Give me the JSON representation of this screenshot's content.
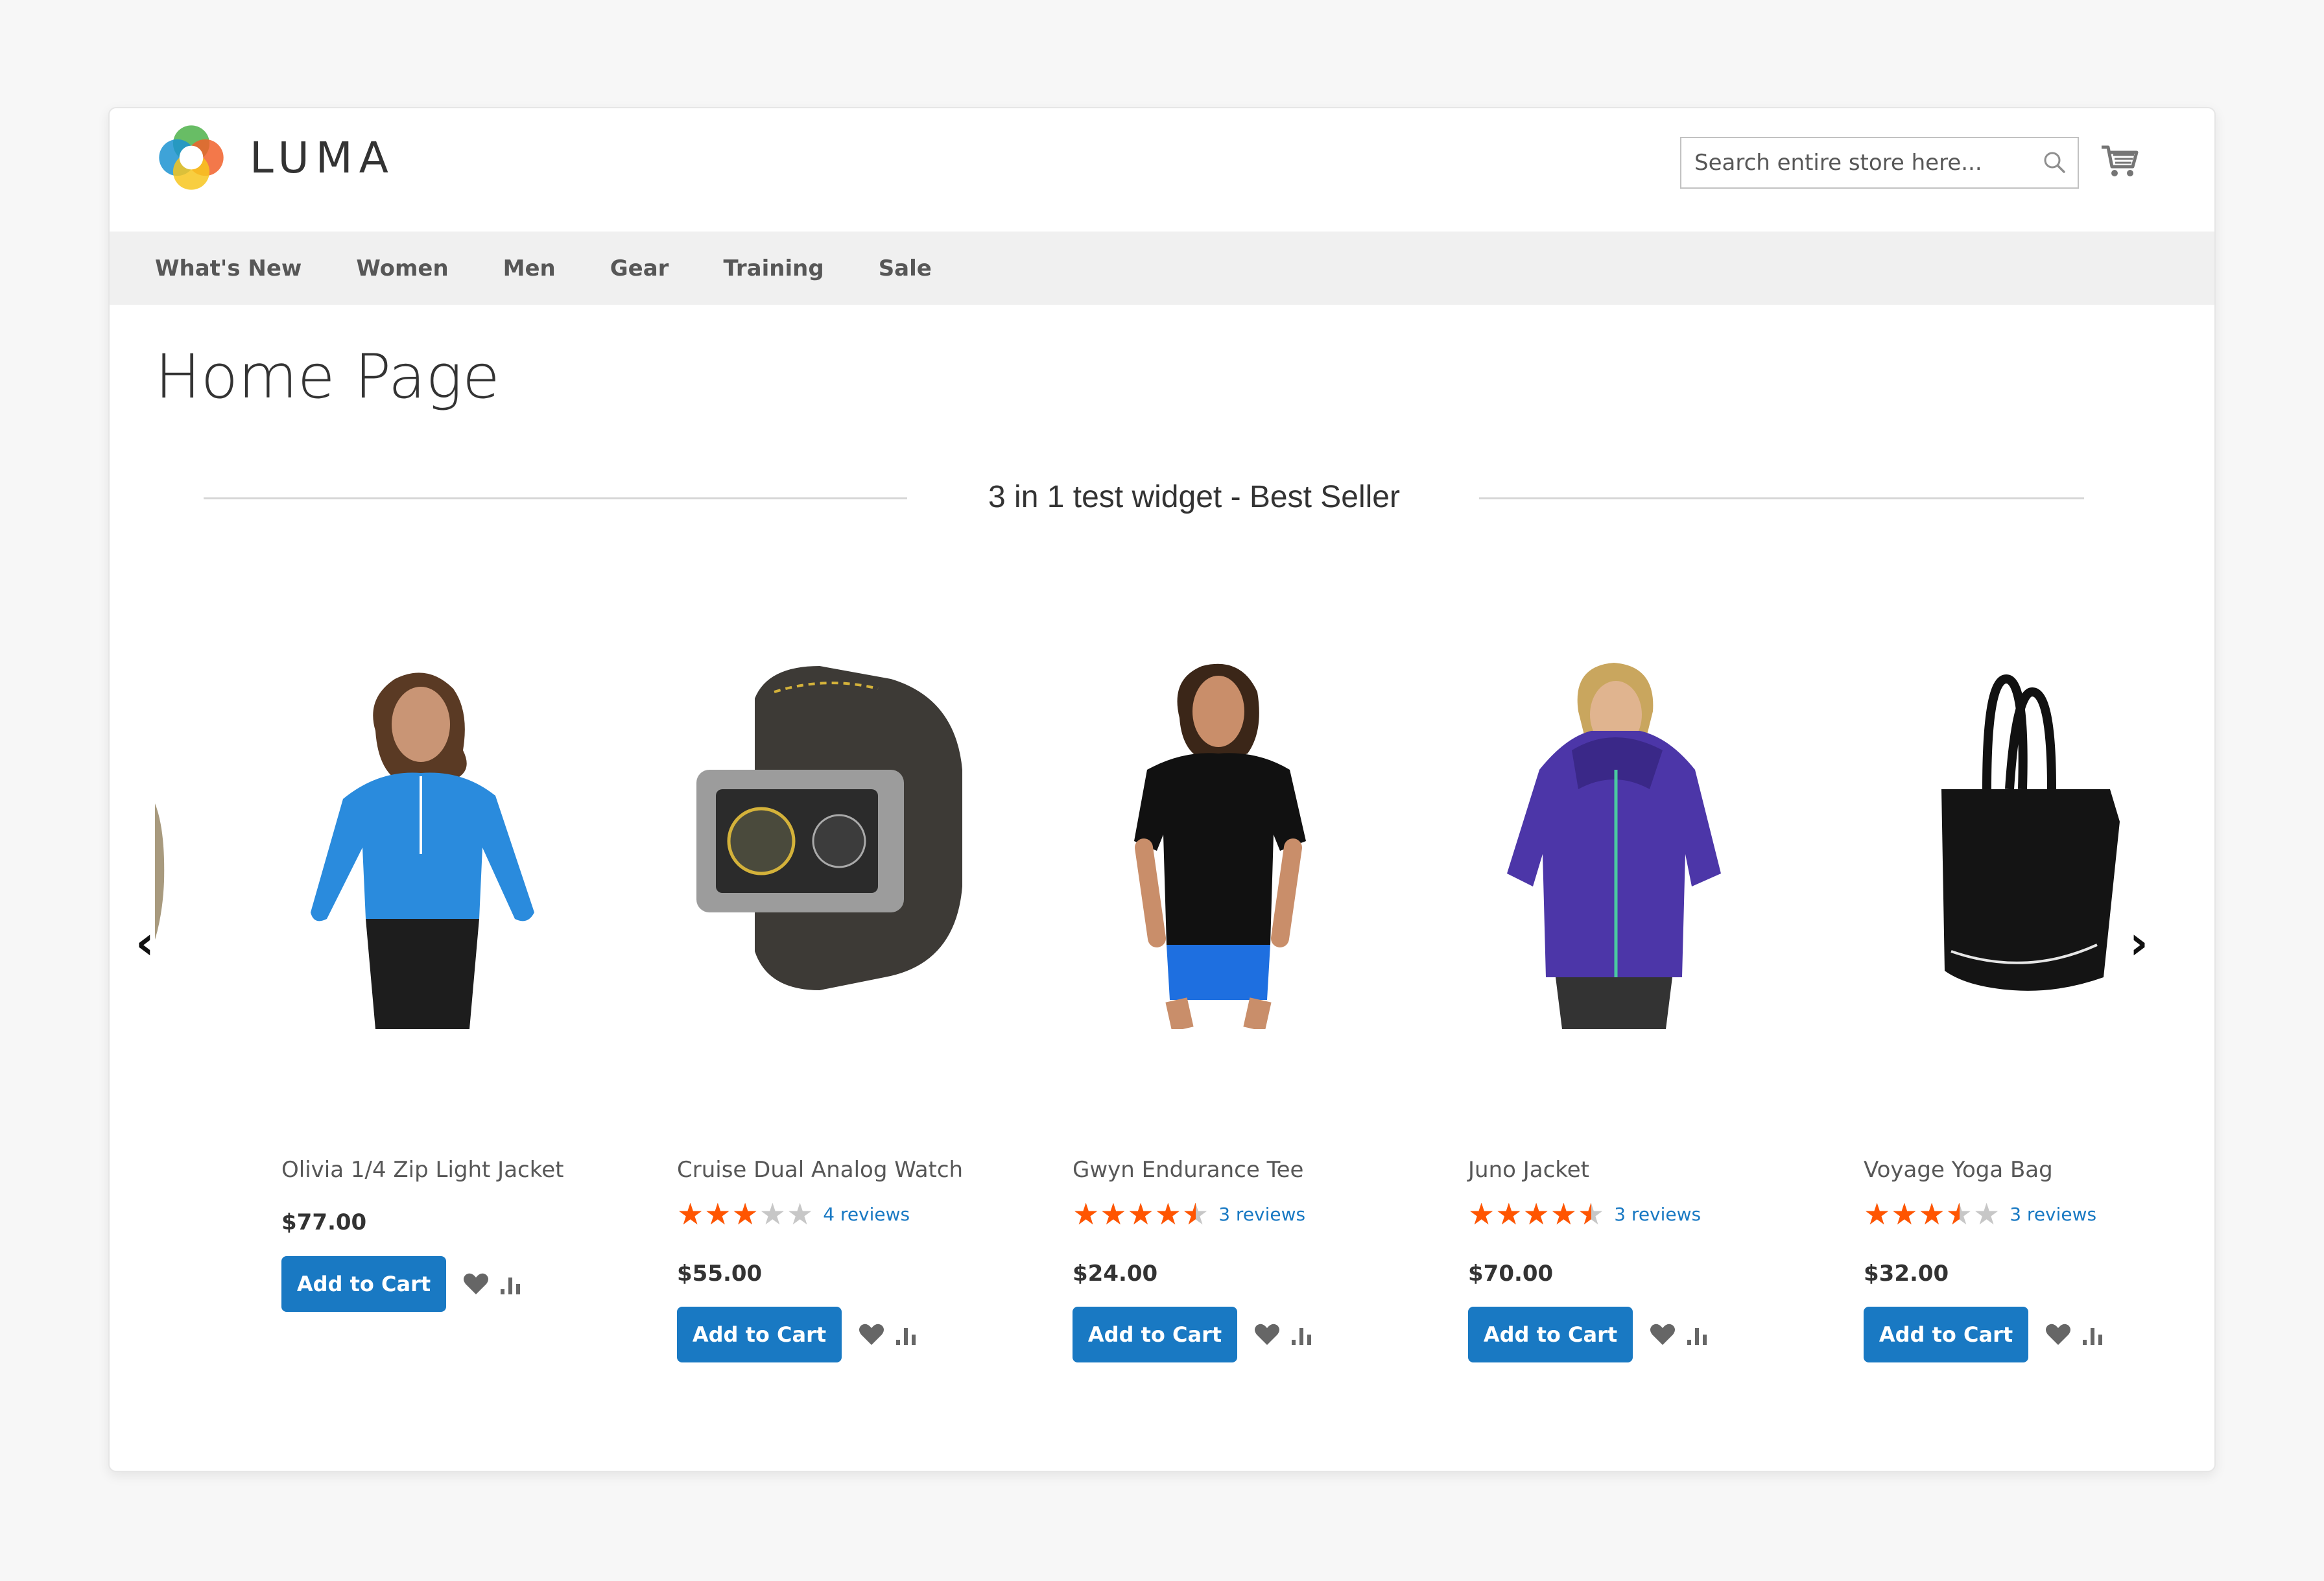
{
  "brand": {
    "name": "LUMA"
  },
  "header": {
    "search_placeholder": "Search entire store here..."
  },
  "nav": [
    "What's New",
    "Women",
    "Men",
    "Gear",
    "Training",
    "Sale"
  ],
  "page_title": "Home Page",
  "widget_title": "3 in 1 test widget - Best Seller",
  "products": [
    {
      "name": "Olivia 1/4 Zip Light Jacket",
      "price": "$77.00",
      "rating": null,
      "reviews": "",
      "add_label": "Add to Cart"
    },
    {
      "name": "Cruise Dual Analog Watch",
      "price": "$55.00",
      "rating": 3,
      "reviews": "4 reviews",
      "add_label": "Add to Cart"
    },
    {
      "name": "Gwyn Endurance Tee",
      "price": "$24.00",
      "rating": 4.5,
      "reviews": "3 reviews",
      "add_label": "Add to Cart"
    },
    {
      "name": "Juno Jacket",
      "price": "$70.00",
      "rating": 4.5,
      "reviews": "3 reviews",
      "add_label": "Add to Cart"
    },
    {
      "name": "Voyage Yoga Bag",
      "price": "$32.00",
      "rating": 3.5,
      "reviews": "3 reviews",
      "add_label": "Add to Cart"
    }
  ],
  "carousel": {
    "pages": 3,
    "active_page": 3
  },
  "icons": {
    "search": "search-icon",
    "cart": "cart-icon",
    "wishlist": "heart-icon",
    "compare": "compare-bars-icon",
    "prev": "chevron-left-icon",
    "next": "chevron-right-icon"
  },
  "colors": {
    "accent": "#1979c3",
    "star": "#ff5501",
    "star_empty": "#c7c7c7",
    "nav_bg": "#f0f0f0"
  }
}
